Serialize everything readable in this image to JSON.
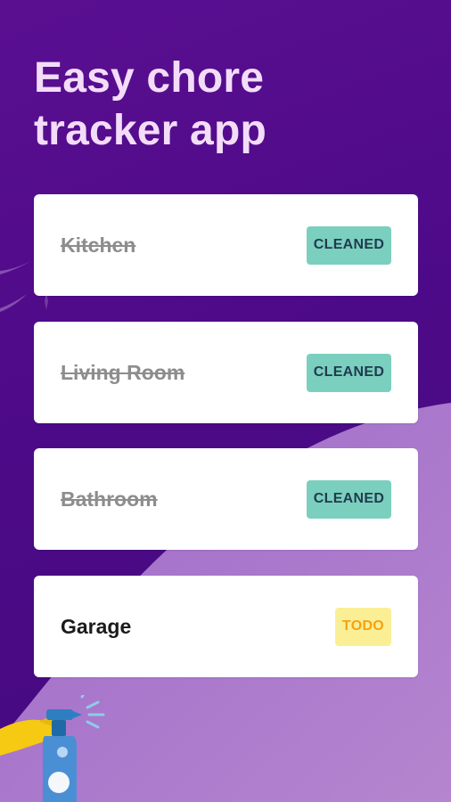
{
  "hero": {
    "title": "Easy chore tracker app"
  },
  "chores": [
    {
      "name": "Kitchen",
      "status": "CLEANED"
    },
    {
      "name": "Living Room",
      "status": "CLEANED"
    },
    {
      "name": "Bathroom",
      "status": "CLEANED"
    },
    {
      "name": "Garage",
      "status": "TODO"
    }
  ],
  "colors": {
    "background": "#4d0a88",
    "wave": "#b07fd0",
    "title": "#f3dcf8",
    "cleaned_badge": "#7bcfbe",
    "cleaned_text": "#1f3b4f",
    "todo_badge": "#fbef96",
    "todo_text": "#f5a20f",
    "done_text": "#8d8d8d"
  },
  "icons": {
    "sparkle": "sparkle-icon",
    "spray": "spray-bottle-icon"
  }
}
